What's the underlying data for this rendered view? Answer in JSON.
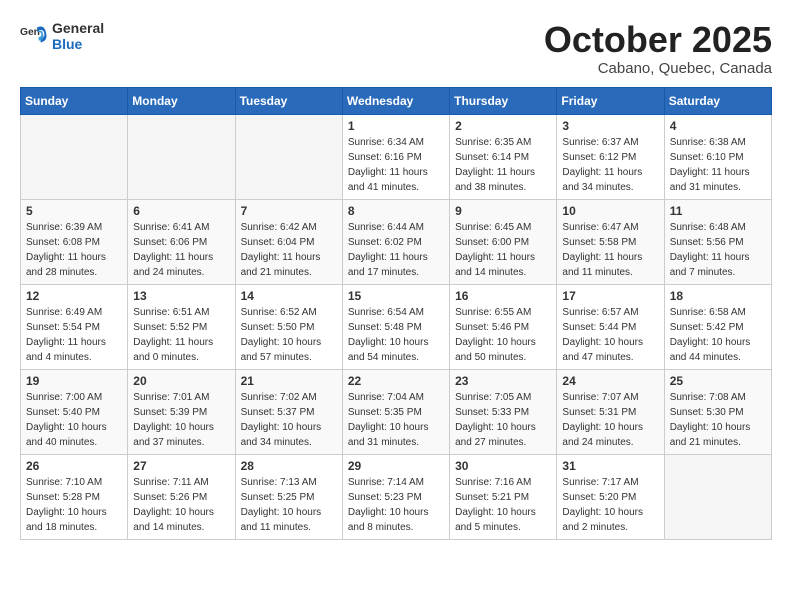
{
  "header": {
    "logo_general": "General",
    "logo_blue": "Blue",
    "month_title": "October 2025",
    "subtitle": "Cabano, Quebec, Canada"
  },
  "days_of_week": [
    "Sunday",
    "Monday",
    "Tuesday",
    "Wednesday",
    "Thursday",
    "Friday",
    "Saturday"
  ],
  "weeks": [
    [
      {
        "day": "",
        "sunrise": "",
        "sunset": "",
        "daylight": ""
      },
      {
        "day": "",
        "sunrise": "",
        "sunset": "",
        "daylight": ""
      },
      {
        "day": "",
        "sunrise": "",
        "sunset": "",
        "daylight": ""
      },
      {
        "day": "1",
        "sunrise": "Sunrise: 6:34 AM",
        "sunset": "Sunset: 6:16 PM",
        "daylight": "Daylight: 11 hours and 41 minutes."
      },
      {
        "day": "2",
        "sunrise": "Sunrise: 6:35 AM",
        "sunset": "Sunset: 6:14 PM",
        "daylight": "Daylight: 11 hours and 38 minutes."
      },
      {
        "day": "3",
        "sunrise": "Sunrise: 6:37 AM",
        "sunset": "Sunset: 6:12 PM",
        "daylight": "Daylight: 11 hours and 34 minutes."
      },
      {
        "day": "4",
        "sunrise": "Sunrise: 6:38 AM",
        "sunset": "Sunset: 6:10 PM",
        "daylight": "Daylight: 11 hours and 31 minutes."
      }
    ],
    [
      {
        "day": "5",
        "sunrise": "Sunrise: 6:39 AM",
        "sunset": "Sunset: 6:08 PM",
        "daylight": "Daylight: 11 hours and 28 minutes."
      },
      {
        "day": "6",
        "sunrise": "Sunrise: 6:41 AM",
        "sunset": "Sunset: 6:06 PM",
        "daylight": "Daylight: 11 hours and 24 minutes."
      },
      {
        "day": "7",
        "sunrise": "Sunrise: 6:42 AM",
        "sunset": "Sunset: 6:04 PM",
        "daylight": "Daylight: 11 hours and 21 minutes."
      },
      {
        "day": "8",
        "sunrise": "Sunrise: 6:44 AM",
        "sunset": "Sunset: 6:02 PM",
        "daylight": "Daylight: 11 hours and 17 minutes."
      },
      {
        "day": "9",
        "sunrise": "Sunrise: 6:45 AM",
        "sunset": "Sunset: 6:00 PM",
        "daylight": "Daylight: 11 hours and 14 minutes."
      },
      {
        "day": "10",
        "sunrise": "Sunrise: 6:47 AM",
        "sunset": "Sunset: 5:58 PM",
        "daylight": "Daylight: 11 hours and 11 minutes."
      },
      {
        "day": "11",
        "sunrise": "Sunrise: 6:48 AM",
        "sunset": "Sunset: 5:56 PM",
        "daylight": "Daylight: 11 hours and 7 minutes."
      }
    ],
    [
      {
        "day": "12",
        "sunrise": "Sunrise: 6:49 AM",
        "sunset": "Sunset: 5:54 PM",
        "daylight": "Daylight: 11 hours and 4 minutes."
      },
      {
        "day": "13",
        "sunrise": "Sunrise: 6:51 AM",
        "sunset": "Sunset: 5:52 PM",
        "daylight": "Daylight: 11 hours and 0 minutes."
      },
      {
        "day": "14",
        "sunrise": "Sunrise: 6:52 AM",
        "sunset": "Sunset: 5:50 PM",
        "daylight": "Daylight: 10 hours and 57 minutes."
      },
      {
        "day": "15",
        "sunrise": "Sunrise: 6:54 AM",
        "sunset": "Sunset: 5:48 PM",
        "daylight": "Daylight: 10 hours and 54 minutes."
      },
      {
        "day": "16",
        "sunrise": "Sunrise: 6:55 AM",
        "sunset": "Sunset: 5:46 PM",
        "daylight": "Daylight: 10 hours and 50 minutes."
      },
      {
        "day": "17",
        "sunrise": "Sunrise: 6:57 AM",
        "sunset": "Sunset: 5:44 PM",
        "daylight": "Daylight: 10 hours and 47 minutes."
      },
      {
        "day": "18",
        "sunrise": "Sunrise: 6:58 AM",
        "sunset": "Sunset: 5:42 PM",
        "daylight": "Daylight: 10 hours and 44 minutes."
      }
    ],
    [
      {
        "day": "19",
        "sunrise": "Sunrise: 7:00 AM",
        "sunset": "Sunset: 5:40 PM",
        "daylight": "Daylight: 10 hours and 40 minutes."
      },
      {
        "day": "20",
        "sunrise": "Sunrise: 7:01 AM",
        "sunset": "Sunset: 5:39 PM",
        "daylight": "Daylight: 10 hours and 37 minutes."
      },
      {
        "day": "21",
        "sunrise": "Sunrise: 7:02 AM",
        "sunset": "Sunset: 5:37 PM",
        "daylight": "Daylight: 10 hours and 34 minutes."
      },
      {
        "day": "22",
        "sunrise": "Sunrise: 7:04 AM",
        "sunset": "Sunset: 5:35 PM",
        "daylight": "Daylight: 10 hours and 31 minutes."
      },
      {
        "day": "23",
        "sunrise": "Sunrise: 7:05 AM",
        "sunset": "Sunset: 5:33 PM",
        "daylight": "Daylight: 10 hours and 27 minutes."
      },
      {
        "day": "24",
        "sunrise": "Sunrise: 7:07 AM",
        "sunset": "Sunset: 5:31 PM",
        "daylight": "Daylight: 10 hours and 24 minutes."
      },
      {
        "day": "25",
        "sunrise": "Sunrise: 7:08 AM",
        "sunset": "Sunset: 5:30 PM",
        "daylight": "Daylight: 10 hours and 21 minutes."
      }
    ],
    [
      {
        "day": "26",
        "sunrise": "Sunrise: 7:10 AM",
        "sunset": "Sunset: 5:28 PM",
        "daylight": "Daylight: 10 hours and 18 minutes."
      },
      {
        "day": "27",
        "sunrise": "Sunrise: 7:11 AM",
        "sunset": "Sunset: 5:26 PM",
        "daylight": "Daylight: 10 hours and 14 minutes."
      },
      {
        "day": "28",
        "sunrise": "Sunrise: 7:13 AM",
        "sunset": "Sunset: 5:25 PM",
        "daylight": "Daylight: 10 hours and 11 minutes."
      },
      {
        "day": "29",
        "sunrise": "Sunrise: 7:14 AM",
        "sunset": "Sunset: 5:23 PM",
        "daylight": "Daylight: 10 hours and 8 minutes."
      },
      {
        "day": "30",
        "sunrise": "Sunrise: 7:16 AM",
        "sunset": "Sunset: 5:21 PM",
        "daylight": "Daylight: 10 hours and 5 minutes."
      },
      {
        "day": "31",
        "sunrise": "Sunrise: 7:17 AM",
        "sunset": "Sunset: 5:20 PM",
        "daylight": "Daylight: 10 hours and 2 minutes."
      },
      {
        "day": "",
        "sunrise": "",
        "sunset": "",
        "daylight": ""
      }
    ]
  ]
}
